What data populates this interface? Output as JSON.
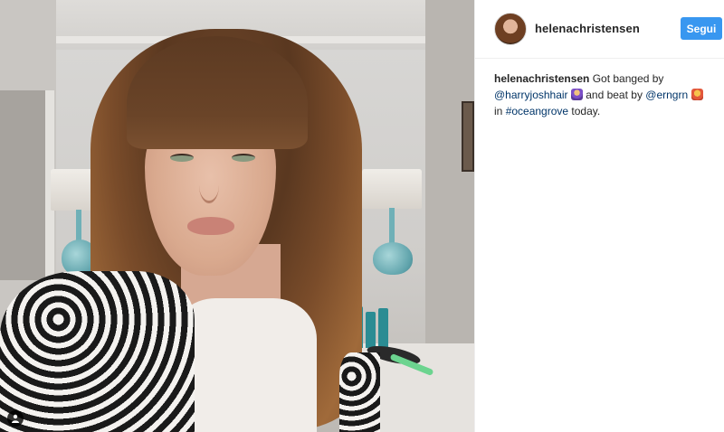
{
  "post": {
    "username": "helenachristensen",
    "follow_label": "Segui",
    "caption": {
      "author": "helenachristensen",
      "part1": " Got banged by ",
      "mention1": "@harryjoshhair",
      "part2": " and beat by ",
      "mention2": "@erngrn",
      "part3": " in ",
      "hashtag": "#oceangrove",
      "part4": " today."
    }
  },
  "icons": {
    "user_tag": "person-icon",
    "emoji1": "haircut-emoji-icon",
    "emoji2": "surfer-emoji-icon"
  },
  "colors": {
    "follow_button": "#3897f0",
    "link": "#003569"
  }
}
